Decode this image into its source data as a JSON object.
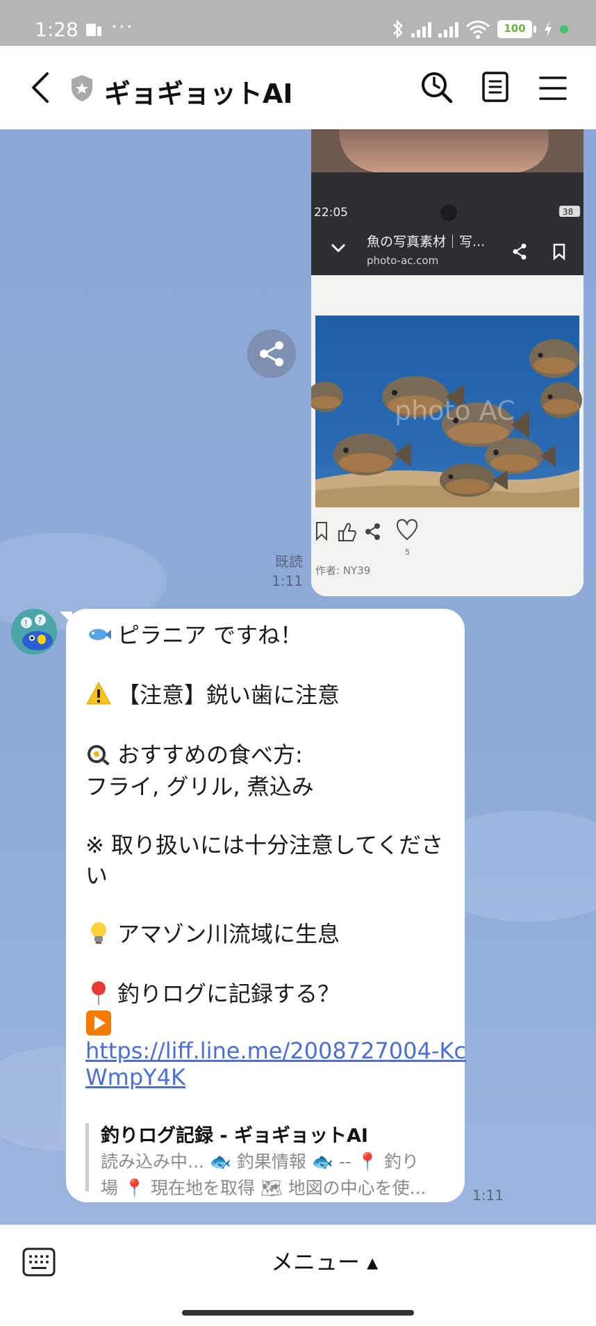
{
  "status_bar": {
    "time": "1:28",
    "dots": "···",
    "battery": "100"
  },
  "header": {
    "title": "ギョギョットAI"
  },
  "photo": {
    "phone_time": "22:05",
    "phone_battery": "38",
    "page_title": "魚の写真素材｜写...",
    "page_url": "photo-ac.com",
    "watermark": "photo AC",
    "like_count": "5",
    "author": "作者:  NY39"
  },
  "sent_message": {
    "read": "既読",
    "time": "1:11"
  },
  "bot_message": {
    "line_1": "ピラニア ですね！",
    "line_2": "【注意】鋭い歯に注意",
    "line_3": "おすすめの食べ方:",
    "line_4": "フライ, グリル, 煮込み",
    "line_5": "※ 取り扱いには十分注意してくださ",
    "line_6": "い",
    "line_7": "アマゾン川流域に生息",
    "line_8": "釣りログに記録する？",
    "link_1": "https://liff.line.me/2008727004-Kc",
    "link_2": "WmpY4K",
    "preview_title": "釣りログ記録 - ギョギョットAI",
    "preview_desc_1": "読み込み中... 🐟 釣果情報 🐟 -- 📍 釣り",
    "preview_desc_2": "場 📍 現在地を取得 🗺 地図の中心を使...",
    "time": "1:11"
  },
  "bottom_bar": {
    "menu_label": "メニュー ▴"
  },
  "colors": {
    "chat_bg": "#8eaad9",
    "link": "#4a6fd8",
    "header_bg": "#ffffff"
  }
}
